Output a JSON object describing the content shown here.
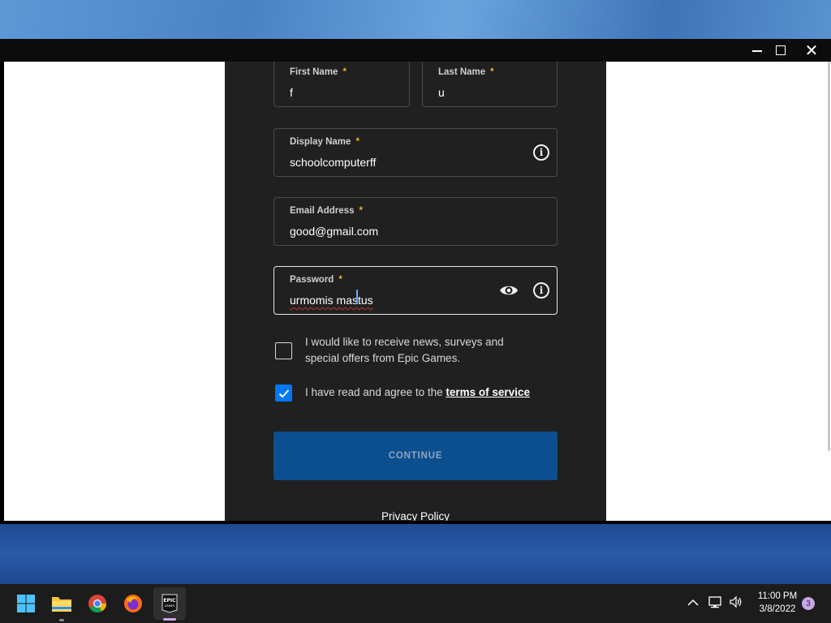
{
  "form": {
    "first_name": {
      "label": "First Name",
      "required": "*",
      "value": "f"
    },
    "last_name": {
      "label": "Last Name",
      "required": "*",
      "value": "u"
    },
    "display_name": {
      "label": "Display Name",
      "required": "*",
      "value": "schoolcomputerff"
    },
    "email": {
      "label": "Email Address",
      "required": "*",
      "value": "good@gmail.com"
    },
    "password": {
      "label": "Password",
      "required": "*",
      "value": "urmomis mastus"
    },
    "news_optin": {
      "text": "I would like to receive news, surveys and special offers from Epic Games.",
      "checked": false
    },
    "tos": {
      "text_prefix": "I have read and agree to the ",
      "link": "terms of service",
      "checked": true
    },
    "continue_label": "CONTINUE",
    "privacy_link": "Privacy Policy"
  },
  "taskbar": {
    "apps": [
      "start-icon",
      "file-explorer-icon",
      "chrome-icon",
      "firefox-icon",
      "epic-games-icon"
    ],
    "epic_label": "EPIC\nGAMES",
    "time": "11:00 PM",
    "date": "3/8/2022",
    "notifications": "3"
  },
  "colors": {
    "panel_bg": "#202020",
    "accent_blue": "#0078f2",
    "button_blue": "#0b4f8f",
    "required_star": "#f0b429"
  }
}
